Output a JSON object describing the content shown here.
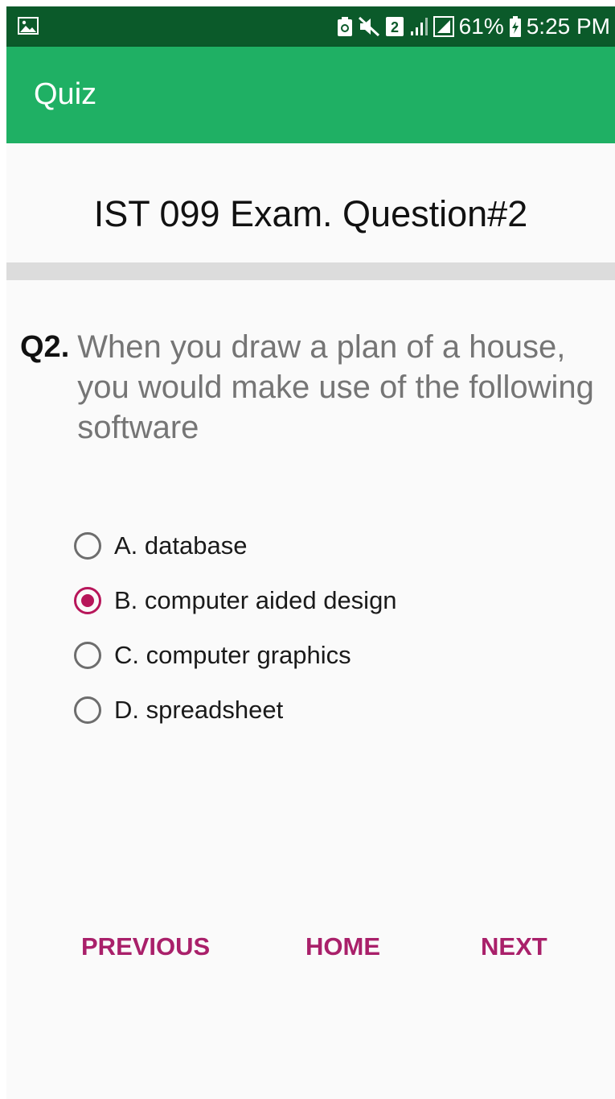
{
  "status_bar": {
    "battery": "61%",
    "time": "5:25 PM",
    "sim_badge": "2",
    "icons": [
      "image-icon",
      "recycle-battery-icon",
      "mute-icon",
      "sim-2-icon",
      "signal-icon",
      "signal-box-icon",
      "battery-charging-icon"
    ]
  },
  "app_bar": {
    "title": "Quiz",
    "color": "#1fb064"
  },
  "exam": {
    "title": "IST 099 Exam. Question#2"
  },
  "question": {
    "number": "Q2.",
    "text": "When you draw a plan of a house, you would make use of the following software"
  },
  "options": [
    {
      "label": "A. database",
      "checked": false
    },
    {
      "label": "B. computer aided design",
      "checked": true
    },
    {
      "label": "C. computer graphics",
      "checked": false
    },
    {
      "label": "D. spreadsheet",
      "checked": false
    }
  ],
  "navigation": {
    "previous_label": "PREVIOUS",
    "home_label": "HOME",
    "next_label": "NEXT"
  },
  "colors": {
    "accent": "#a9206a",
    "status_bar": "#0b5a2a"
  }
}
